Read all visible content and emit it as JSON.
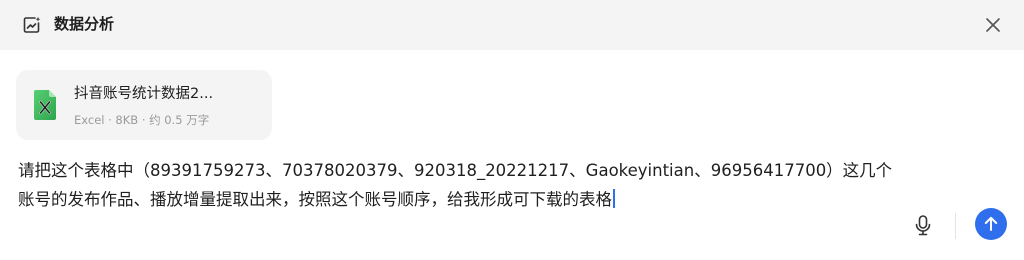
{
  "header": {
    "title": "数据分析",
    "icon": "chart-analysis-icon",
    "close_icon": "close-icon"
  },
  "attachment": {
    "file_name": "抖音账号统计数据2...",
    "file_meta": "Excel · 8KB · 约 0.5 万字",
    "file_icon": "excel-file-icon",
    "icon_color": "#3fb950"
  },
  "input": {
    "text": "请把这个表格中（89391759273、70378020379、920318_20221217、Gaokeyintian、96956417700）这几个账号的发布作品、播放增量提取出来，按照这个账号顺序，给我形成可下载的表格"
  },
  "controls": {
    "mic_icon": "microphone-icon",
    "send_icon": "arrow-up-icon",
    "accent_color": "#2f6fed"
  }
}
